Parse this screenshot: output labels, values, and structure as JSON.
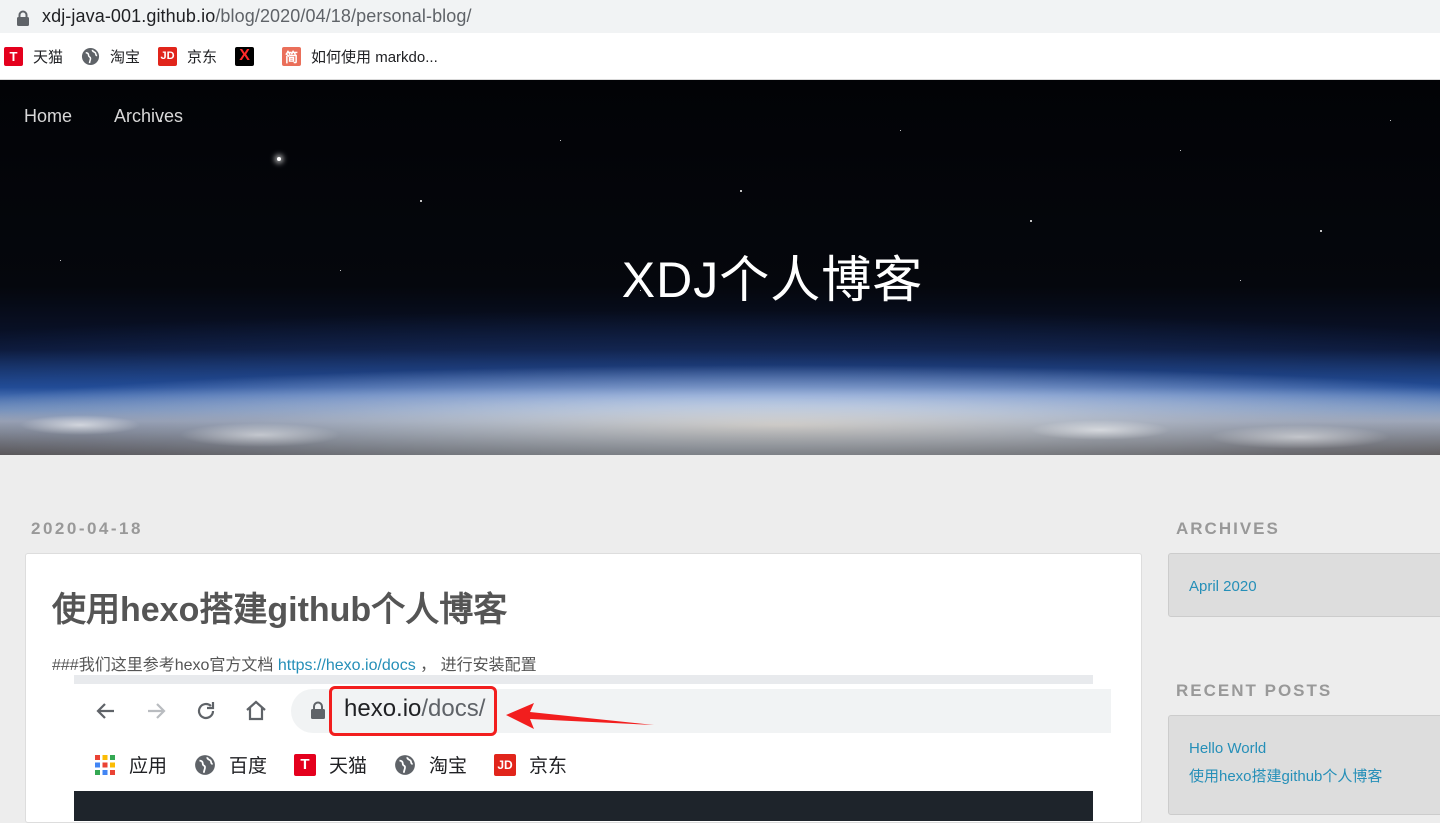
{
  "browser": {
    "url_host": "xdj-java-001.github.io",
    "url_path": "/blog/2020/04/18/personal-blog/",
    "bookmarks": [
      {
        "label": "天猫",
        "icon": "tmall-icon"
      },
      {
        "label": "淘宝",
        "icon": "globe-icon"
      },
      {
        "label": "京东",
        "icon": "jd-icon"
      },
      {
        "label": "",
        "icon": "x-icon"
      },
      {
        "label": "如何使用 markdo...",
        "icon": "jianshu-icon"
      }
    ],
    "icon_text": {
      "tmall": "T",
      "jd": "JD",
      "x": "X",
      "jianshu": "简"
    }
  },
  "nav": {
    "home": "Home",
    "archives": "Archives"
  },
  "hero": {
    "title": "XDJ个人博客"
  },
  "post": {
    "date": "2020-04-18",
    "title": "使用hexo搭建github个人博客",
    "intro_prefix": "###我们这里参考hexo官方文档 ",
    "intro_link": "https://hexo.io/docs",
    "intro_suffix": " ，  进行安装配置",
    "screenshot": {
      "url_host": "hexo.io",
      "url_path": "/docs/",
      "bookmarks": [
        {
          "label": "应用",
          "icon": "apps-grid-icon"
        },
        {
          "label": "百度",
          "icon": "globe-icon"
        },
        {
          "label": "天猫",
          "icon": "tmall-icon"
        },
        {
          "label": "淘宝",
          "icon": "globe-icon"
        },
        {
          "label": "京东",
          "icon": "jd-icon"
        }
      ]
    }
  },
  "sidebar": {
    "archives_heading": "ARCHIVES",
    "archives": [
      {
        "label": "April 2020"
      }
    ],
    "recent_heading": "RECENT POSTS",
    "recent": [
      {
        "label": "Hello World"
      },
      {
        "label": "使用hexo搭建github个人博客"
      }
    ]
  },
  "colors": {
    "link": "#258fb8",
    "accent_red": "#f21e1e",
    "tmall_red": "#e4001d",
    "jd_red": "#e1251b"
  }
}
